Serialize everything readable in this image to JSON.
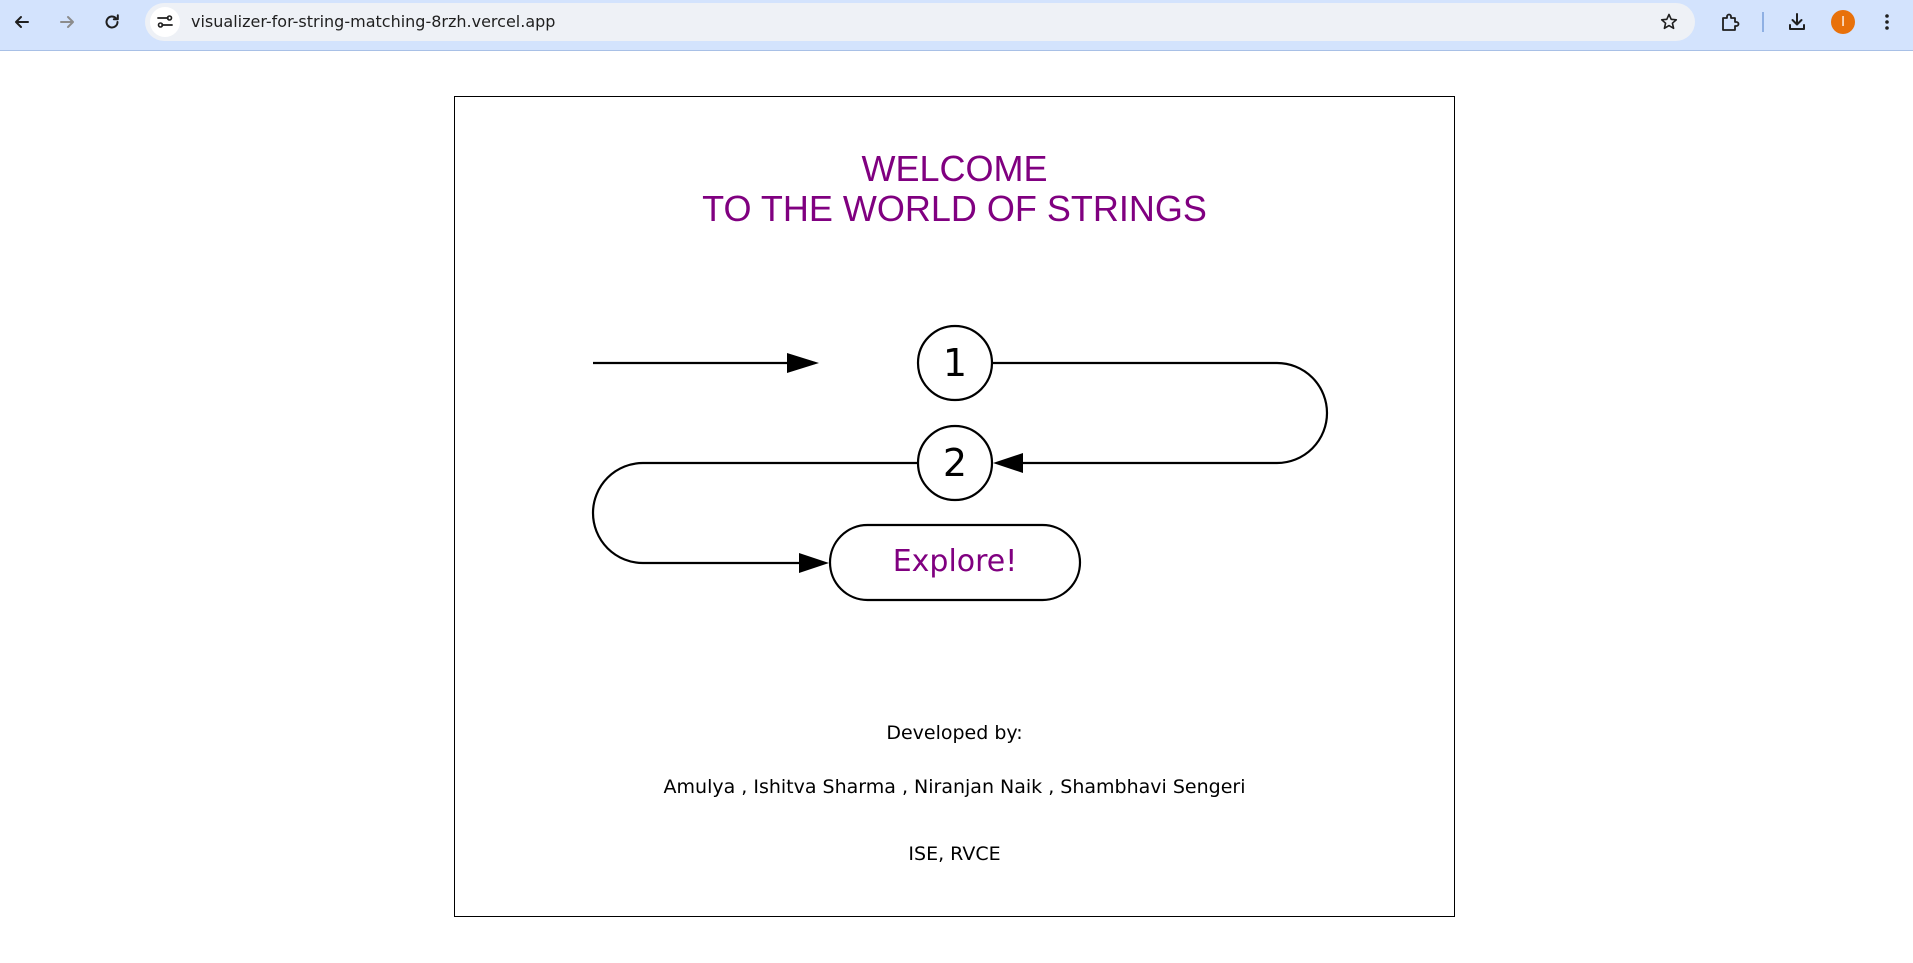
{
  "browser": {
    "url": "visualizer-for-string-matching-8rzh.vercel.app",
    "avatar_initial": "I",
    "icons": [
      "back-icon",
      "forward-icon",
      "reload-icon",
      "site-info-icon",
      "bookmark-star-icon",
      "extensions-icon",
      "download-icon",
      "menu-icon"
    ]
  },
  "page": {
    "title_line1": "WELCOME",
    "title_line2": "TO THE WORLD OF STRINGS",
    "title_color": "#800080",
    "diagram": {
      "node_1": "1",
      "node_2": "2",
      "explore_label": "Explore!"
    },
    "developed_by_label": "Developed by:",
    "developers": "Amulya , Ishitva Sharma , Niranjan Naik , Shambhavi Sengeri",
    "institution": "ISE, RVCE"
  }
}
